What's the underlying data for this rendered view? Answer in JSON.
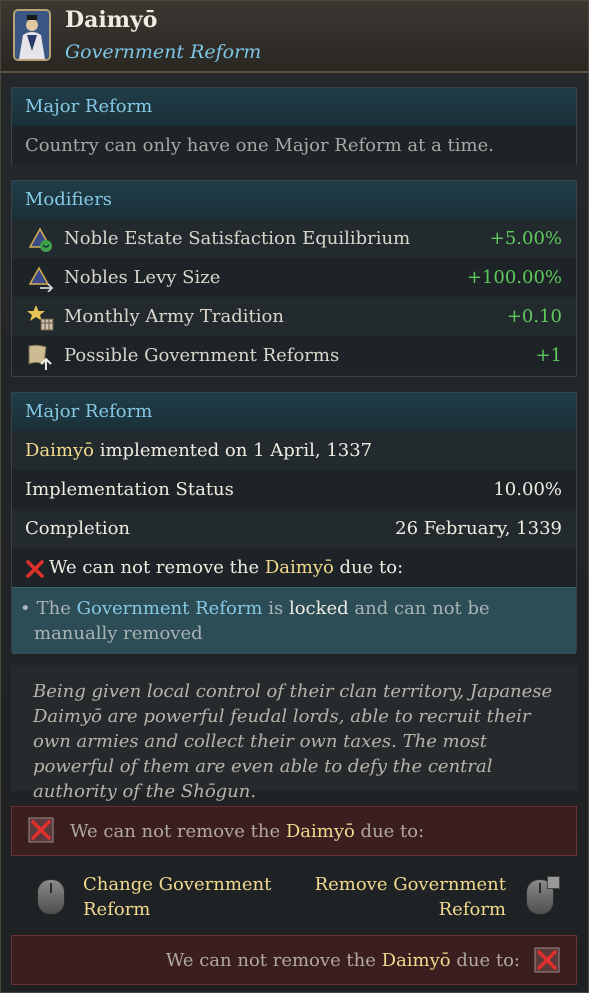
{
  "header": {
    "title": "Daimyō",
    "subtitle": "Government Reform"
  },
  "major_reform_box": {
    "heading": "Major Reform",
    "text": "Country can only have one Major Reform at a time."
  },
  "modifiers": {
    "heading": "Modifiers",
    "items": [
      {
        "label": "Noble Estate Satisfaction Equilibrium",
        "value": "+5.00%",
        "icon": "noble-satisfaction-icon"
      },
      {
        "label": "Nobles Levy Size",
        "value": "+100.00%",
        "icon": "nobles-levy-icon"
      },
      {
        "label": "Monthly Army Tradition",
        "value": "+0.10",
        "icon": "army-tradition-icon"
      },
      {
        "label": "Possible Government Reforms",
        "value": "+1",
        "icon": "government-reforms-icon"
      }
    ]
  },
  "status": {
    "heading": "Major Reform",
    "implemented_name": "Daimyō",
    "implemented_text": " implemented on 1 April, 1337",
    "impl_label": "Implementation Status",
    "impl_value": "10.00%",
    "completion_label": "Completion",
    "completion_value": "26 February, 1339",
    "cannot_pre": "We can not remove the ",
    "cannot_name": "Daimyō",
    "cannot_post": " due to:",
    "bullet_pre": "The ",
    "bullet_link": "Government Reform",
    "bullet_mid": " is ",
    "bullet_locked": "locked",
    "bullet_post": " and can not be manually removed"
  },
  "description": "Being given local control of their clan territory, Japanese Daimyō are powerful feudal lords, able to recruit their own armies and collect their own taxes. The most powerful of them are even able to defy the central authority of the Shōgun.",
  "warning_top": {
    "pre": "We can not remove the ",
    "name": "Daimyō",
    "post": " due to:"
  },
  "actions": {
    "change_label": "Change Government Reform",
    "remove_label": "Remove Government Reform"
  },
  "warning_bottom": {
    "pre": "We can not remove the ",
    "name": "Daimyō",
    "post": " due to:"
  },
  "colors": {
    "accent_blue": "#86c8e4",
    "positive_green": "#5ec95b",
    "name_gold": "#f1d98e",
    "warning_red": "#3a1e20"
  }
}
